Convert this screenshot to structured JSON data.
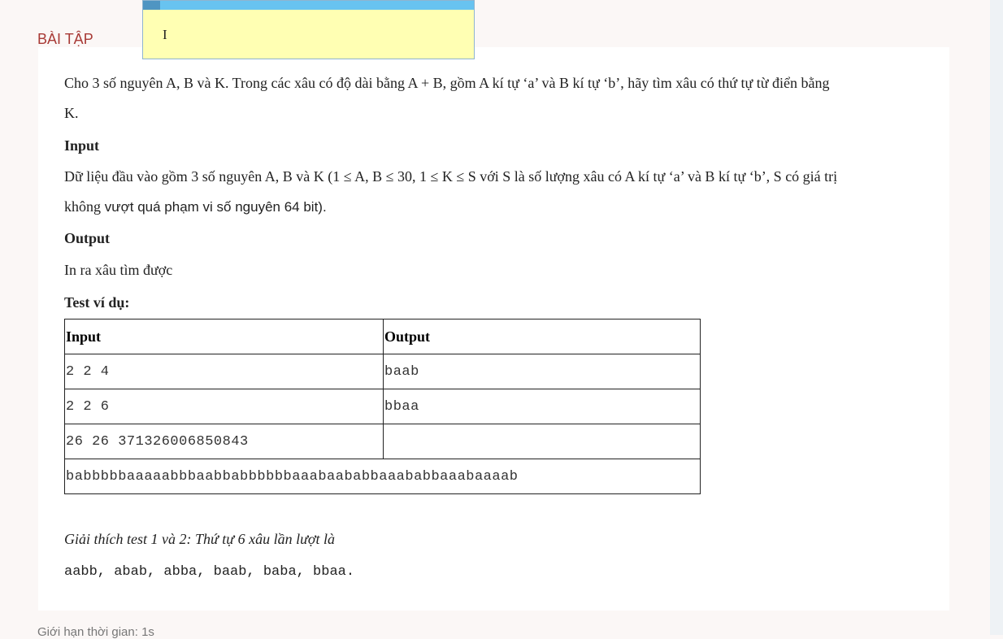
{
  "section": {
    "title": "BÀI TẬP"
  },
  "popup": {
    "text": "I"
  },
  "problem": {
    "statement_line1": "Cho 3 số nguyên A, B và K. Trong các xâu có độ dài bằng A + B, gồm A kí tự ‘a’ và B kí tự ‘b’, hãy tìm xâu có thứ tự từ điển bằng",
    "statement_line2": "K.",
    "input_heading": "Input",
    "input_line1": "Dữ liệu đầu vào gồm 3 số nguyên A, B và K (1 ≤ A, B ≤ 30, 1 ≤ K ≤ S với S là số lượng xâu có A kí tự ‘a’ và B kí tự ‘b’, S có giá trị",
    "input_line2_serif": "không",
    "input_line2_sans": " vượt quá phạm vi số nguyên 64 bit).",
    "output_heading": "Output",
    "output_text": "In ra xâu tìm được",
    "examples_heading": "Test ví dụ:"
  },
  "examples": {
    "headers": [
      "Input",
      "Output"
    ],
    "rows": [
      [
        "2 2 4",
        "baab"
      ],
      [
        "2 2 6",
        "bbaa"
      ],
      [
        "26 26 371326006850843",
        ""
      ]
    ],
    "long_output": "babbbbbaaaaabbbaabbabbbbbbaaabaababbaaababbaaabaaaab"
  },
  "explanation": {
    "line1": "Giải thích test 1 và 2: Thứ tự 6 xâu lần lượt là",
    "line2": "aabb, abab, abba, baab, baba, bbaa."
  },
  "footer": {
    "time_limit": "Giới hạn thời gian: 1s"
  }
}
